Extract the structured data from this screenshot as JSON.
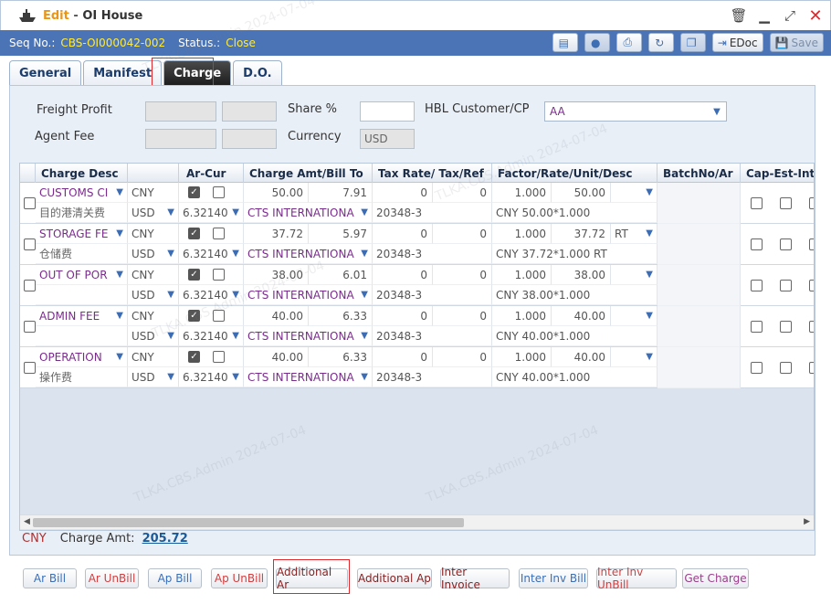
{
  "window": {
    "edit_label": "Edit",
    "separator": " - ",
    "title": "OI House"
  },
  "seq": {
    "seq_label": "Seq No.:",
    "seq_value": "CBS-OI000042-002",
    "status_label": "Status.:",
    "status_value": "Close"
  },
  "toolbar": {
    "edoc_label": "EDoc",
    "save_label": "Save"
  },
  "tabs": [
    {
      "label": "General"
    },
    {
      "label": "Manifest"
    },
    {
      "label": "Charge"
    },
    {
      "label": "D.O."
    }
  ],
  "form": {
    "freight_profit_label": "Freight Profit",
    "share_label": "Share %",
    "hbl_customer_label": "HBL Customer/CP",
    "hbl_customer_value": "AA",
    "agent_fee_label": "Agent Fee",
    "currency_label": "Currency",
    "currency_placeholder": "USD"
  },
  "grid": {
    "headers": [
      "Charge Desc",
      "Ar-Cur",
      "Charge Amt/Bill To",
      "Tax Rate/ Tax/Ref",
      "Factor/Rate/Unit/Desc",
      "BatchNo/Ar",
      "Cap-Est-Inter"
    ],
    "rows": [
      {
        "desc": "CUSTOMS CI",
        "desc_sub": "目的港清关费",
        "cur": "CNY",
        "cur2": "USD",
        "rate": "6.32140",
        "amt": "50.00",
        "amt2": "7.91",
        "bill_to": "CTS INTERNATIONA",
        "tax_rate": "0",
        "tax": "0",
        "ref": "20348-3",
        "factor": "1.000",
        "unit_rate": "50.00",
        "unit": "",
        "desc_calc": "CNY 50.00*1.000",
        "ar_checked": true
      },
      {
        "desc": "STORAGE FE",
        "desc_sub": "仓储费",
        "cur": "CNY",
        "cur2": "USD",
        "rate": "6.32140",
        "amt": "37.72",
        "amt2": "5.97",
        "bill_to": "CTS INTERNATIONA",
        "tax_rate": "0",
        "tax": "0",
        "ref": "20348-3",
        "factor": "1.000",
        "unit_rate": "37.72",
        "unit": "RT",
        "desc_calc": "CNY 37.72*1.000 RT",
        "ar_checked": true
      },
      {
        "desc": "OUT OF POR",
        "desc_sub": "",
        "cur": "CNY",
        "cur2": "USD",
        "rate": "6.32140",
        "amt": "38.00",
        "amt2": "6.01",
        "bill_to": "CTS INTERNATIONA",
        "tax_rate": "0",
        "tax": "0",
        "ref": "20348-3",
        "factor": "1.000",
        "unit_rate": "38.00",
        "unit": "",
        "desc_calc": "CNY 38.00*1.000",
        "ar_checked": true
      },
      {
        "desc": "ADMIN FEE",
        "desc_sub": "",
        "cur": "CNY",
        "cur2": "USD",
        "rate": "6.32140",
        "amt": "40.00",
        "amt2": "6.33",
        "bill_to": "CTS INTERNATIONA",
        "tax_rate": "0",
        "tax": "0",
        "ref": "20348-3",
        "factor": "1.000",
        "unit_rate": "40.00",
        "unit": "",
        "desc_calc": "CNY 40.00*1.000",
        "ar_checked": true
      },
      {
        "desc": "OPERATION",
        "desc_sub": "操作费",
        "cur": "CNY",
        "cur2": "USD",
        "rate": "6.32140",
        "amt": "40.00",
        "amt2": "6.33",
        "bill_to": "CTS INTERNATIONA",
        "tax_rate": "0",
        "tax": "0",
        "ref": "20348-3",
        "factor": "1.000",
        "unit_rate": "40.00",
        "unit": "",
        "desc_calc": "CNY 40.00*1.000",
        "ar_checked": true
      }
    ]
  },
  "totals": {
    "currency": "CNY",
    "label": "Charge Amt:",
    "amount": "205.72"
  },
  "bottom_buttons": [
    {
      "label": "Ar Bill"
    },
    {
      "label": "Ar UnBill"
    },
    {
      "label": "Ap Bill"
    },
    {
      "label": "Ap UnBill"
    },
    {
      "label": "Additional Ar"
    },
    {
      "label": "Additional Ap"
    },
    {
      "label": "Inter Invoice"
    },
    {
      "label": "Inter Inv Bill"
    },
    {
      "label": "Inter Inv UnBill"
    },
    {
      "label": "Get Charge"
    }
  ],
  "watermark": "TLKA.CBS.Admin 2024-07-04",
  "colors": {
    "header_blue": "#4a74b5",
    "seq_value_yellow": "#ffea3c",
    "highlight_red": "#e0282d",
    "purple_text": "#7a2c8c"
  }
}
